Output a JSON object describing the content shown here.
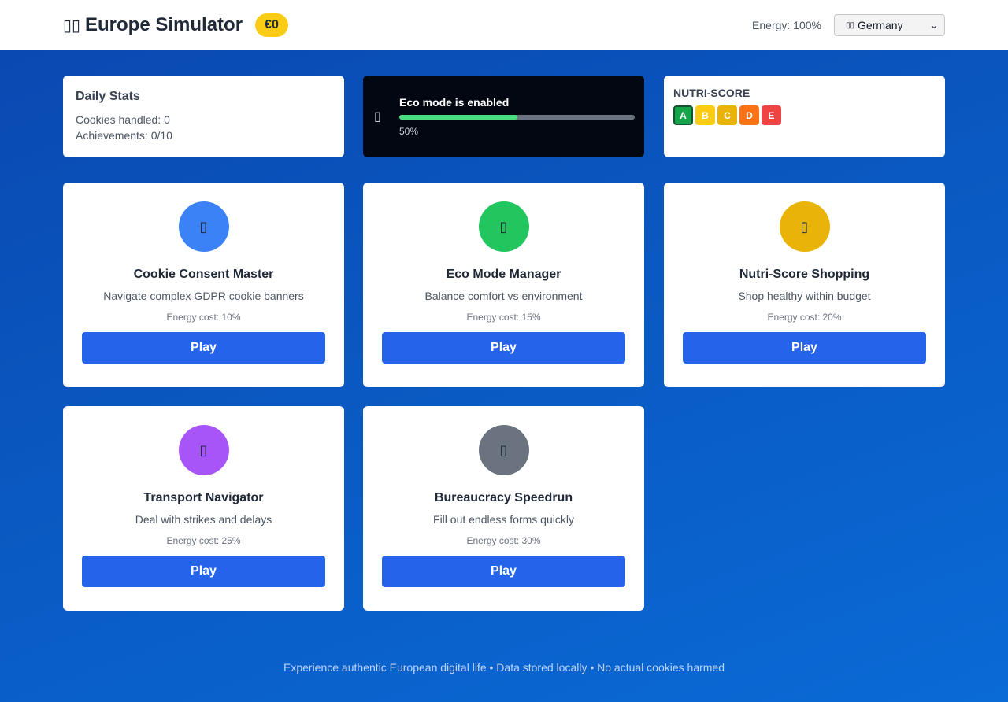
{
  "header": {
    "flag_glyph": "▯▯",
    "title": "Europe Simulator",
    "money": "€0",
    "energy": "Energy: 100%",
    "country_flag": "▯▯",
    "country": "Germany"
  },
  "stats": {
    "daily_title": "Daily Stats",
    "cookies_handled": "Cookies handled: 0",
    "achievements": "Achievements: 0/10"
  },
  "eco": {
    "icon": "leaf-icon",
    "icon_glyph": "▯",
    "label": "Eco mode is enabled",
    "percent_label": "50%",
    "progress": 0.5,
    "fill_color": "#4ade80"
  },
  "nutri": {
    "title": "NUTRI-SCORE",
    "grades": [
      {
        "label": "A",
        "color": "#16a34a",
        "active": true
      },
      {
        "label": "B",
        "color": "#facc15",
        "active": false
      },
      {
        "label": "C",
        "color": "#eab308",
        "active": false
      },
      {
        "label": "D",
        "color": "#f97316",
        "active": false
      },
      {
        "label": "E",
        "color": "#ef4444",
        "active": false
      }
    ]
  },
  "games": [
    {
      "title": "Cookie Consent Master",
      "description": "Navigate complex GDPR cookie banners",
      "cost": "Energy cost: 10%",
      "play": "Play",
      "icon": "cookie-icon",
      "icon_glyph": "▯",
      "color": "#3b82f6"
    },
    {
      "title": "Eco Mode Manager",
      "description": "Balance comfort vs environment",
      "cost": "Energy cost: 15%",
      "play": "Play",
      "icon": "leaf-icon",
      "icon_glyph": "▯",
      "color": "#22c55e"
    },
    {
      "title": "Nutri-Score Shopping",
      "description": "Shop healthy within budget",
      "cost": "Energy cost: 20%",
      "play": "Play",
      "icon": "cart-icon",
      "icon_glyph": "▯",
      "color": "#eab308"
    },
    {
      "title": "Transport Navigator",
      "description": "Deal with strikes and delays",
      "cost": "Energy cost: 25%",
      "play": "Play",
      "icon": "train-icon",
      "icon_glyph": "▯",
      "color": "#a855f7"
    },
    {
      "title": "Bureaucracy Speedrun",
      "description": "Fill out endless forms quickly",
      "cost": "Energy cost: 30%",
      "play": "Play",
      "icon": "document-icon",
      "icon_glyph": "▯",
      "color": "#6b7280"
    }
  ],
  "footer": "Experience authentic European digital life • Data stored locally • No actual cookies harmed",
  "colors": {
    "primary": "#2563eb",
    "money_badge": "#facc15",
    "background": "#0a52bd"
  }
}
